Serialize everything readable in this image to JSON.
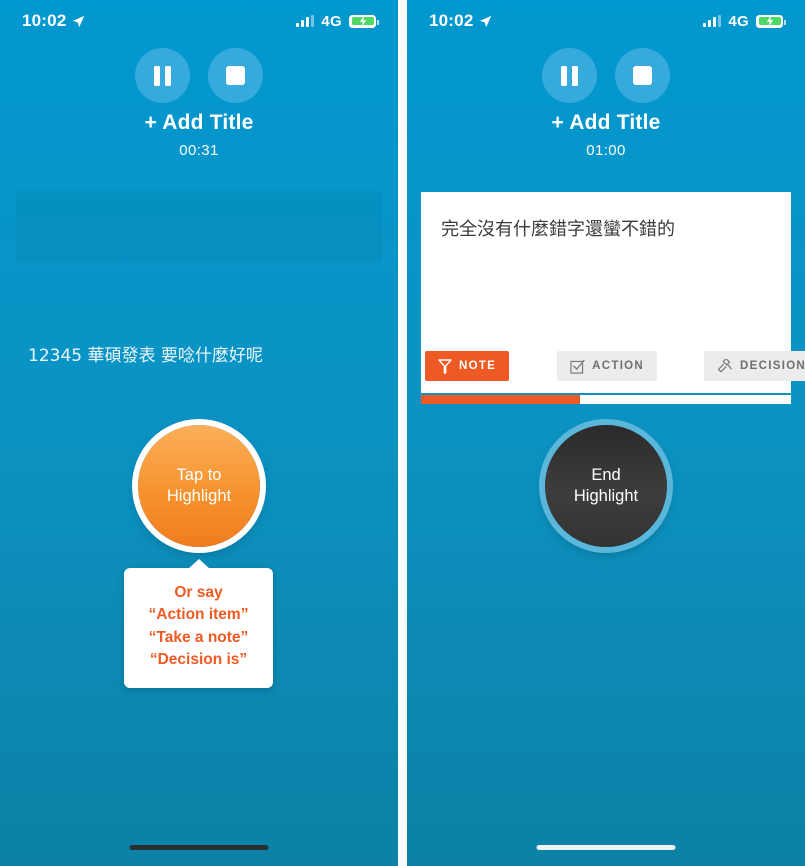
{
  "status_bar": {
    "time": "10:02",
    "location_icon": "location-arrow-icon",
    "signal_icon": "cellular-bars-icon",
    "network": "4G",
    "battery_icon": "battery-charging-icon"
  },
  "colors": {
    "background_top": "#0198cf",
    "background_bottom": "#0d81a6",
    "accent_orange": "#ee5a24",
    "highlight_button_orange": "#f6932f",
    "transport_button_blue": "#36aadd",
    "end_highlight_dark": "#333333",
    "end_highlight_ring": "#5bb7da",
    "chip_inactive_bg": "#ececec",
    "chip_inactive_text": "#6f6f6f",
    "battery_green": "#4cd964",
    "card_white": "#ffffff"
  },
  "left_screen": {
    "transport": {
      "pause_icon": "pause-icon",
      "stop_icon": "stop-icon"
    },
    "add_title_label": "+ Add Title",
    "timer": "00:31",
    "transcript": "12345 華碩發表 要唸什麼好呢",
    "highlight_button": {
      "line1": "Tap to",
      "line2": "Highlight"
    },
    "tooltip": {
      "line1": "Or say",
      "line2": "“Action item”",
      "line3": "“Take a note”",
      "line4": "“Decision is”"
    },
    "home_indicator": "home-indicator-dark"
  },
  "right_screen": {
    "transport": {
      "pause_icon": "pause-icon",
      "stop_icon": "stop-icon"
    },
    "add_title_label": "+ Add Title",
    "timer": "01:00",
    "note_card": {
      "text": "完全沒有什麼錯字還蠻不錯的",
      "chips": [
        {
          "label": "NOTE",
          "icon": "pennant-flag-icon",
          "active": true
        },
        {
          "label": "ACTION",
          "icon": "checkbox-checked-icon",
          "active": false
        },
        {
          "label": "DECISION",
          "icon": "gavel-icon",
          "active": false
        }
      ],
      "progress_percent": 43
    },
    "highlight_button": {
      "line1": "End",
      "line2": "Highlight"
    },
    "close_button_icon": "close-x-icon",
    "home_indicator": "home-indicator-light"
  }
}
